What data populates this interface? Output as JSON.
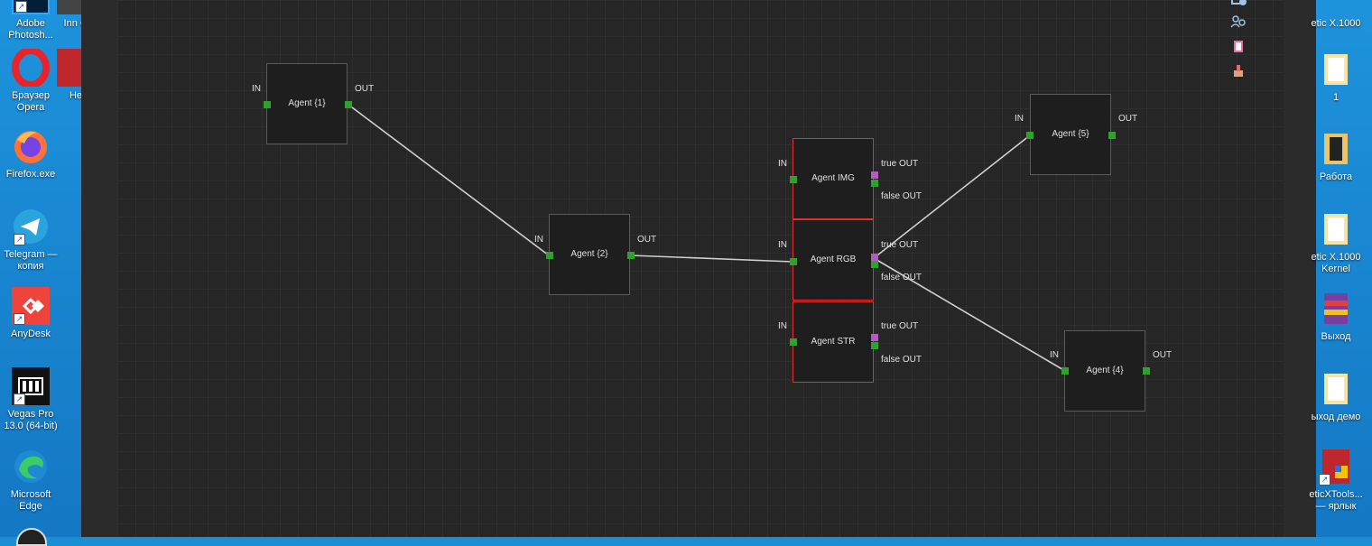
{
  "desktop_left": [
    {
      "label": "Adobe Photosh...",
      "icon": "photoshop-icon"
    },
    {
      "label": "Браузер Opera",
      "icon": "opera-icon"
    },
    {
      "label": "Firefox.exe",
      "icon": "firefox-icon"
    },
    {
      "label": "Telegram — копия",
      "icon": "telegram-icon"
    },
    {
      "label": "AnyDesk",
      "icon": "anydesk-icon"
    },
    {
      "label": "Vegas Pro 13.0 (64-bit)",
      "icon": "vegas-icon"
    },
    {
      "label": "Microsoft Edge",
      "icon": "edge-icon"
    }
  ],
  "desktop_col2": [
    {
      "label": "Inn G",
      "icon": "app-icon"
    },
    {
      "label": "He",
      "icon": "app-icon"
    }
  ],
  "desktop_right": [
    {
      "label": "etic X.1000",
      "icon": "app-icon"
    },
    {
      "label": "1",
      "icon": "folder-icon"
    },
    {
      "label": "Работа",
      "icon": "folder-icon"
    },
    {
      "label": "etic X.1000 Kernel",
      "icon": "folder-icon"
    },
    {
      "label": "Выход",
      "icon": "winrar-icon"
    },
    {
      "label": "ыход демо",
      "icon": "folder-icon"
    },
    {
      "label": "eticXTools... — ярлык",
      "icon": "tools-icon"
    }
  ],
  "nodes": {
    "agent1": {
      "title": "Agent {1}",
      "in": "IN",
      "out": "OUT"
    },
    "agent2": {
      "title": "Agent {2}",
      "in": "IN",
      "out": "OUT"
    },
    "agent5": {
      "title": "Agent {5}",
      "in": "IN",
      "out": "OUT"
    },
    "agent4": {
      "title": "Agent {4}",
      "in": "IN",
      "out": "OUT"
    },
    "agent_img": {
      "title": "Agent IMG",
      "in": "IN",
      "true_out": "true OUT",
      "false_out": "false OUT"
    },
    "agent_rgb": {
      "title": "Agent RGB",
      "in": "IN",
      "true_out": "true OUT",
      "false_out": "false OUT"
    },
    "agent_str": {
      "title": "Agent STR",
      "in": "IN",
      "true_out": "true OUT",
      "false_out": "false OUT"
    }
  },
  "colors": {
    "port": "#2ea12e",
    "condition_port": "#b05cc0",
    "condition_border": "#e03030",
    "link": "#cfcfcf"
  },
  "toolbar": [
    "add-node-icon",
    "group-users-icon",
    "bookmark-icon",
    "brush-icon"
  ]
}
